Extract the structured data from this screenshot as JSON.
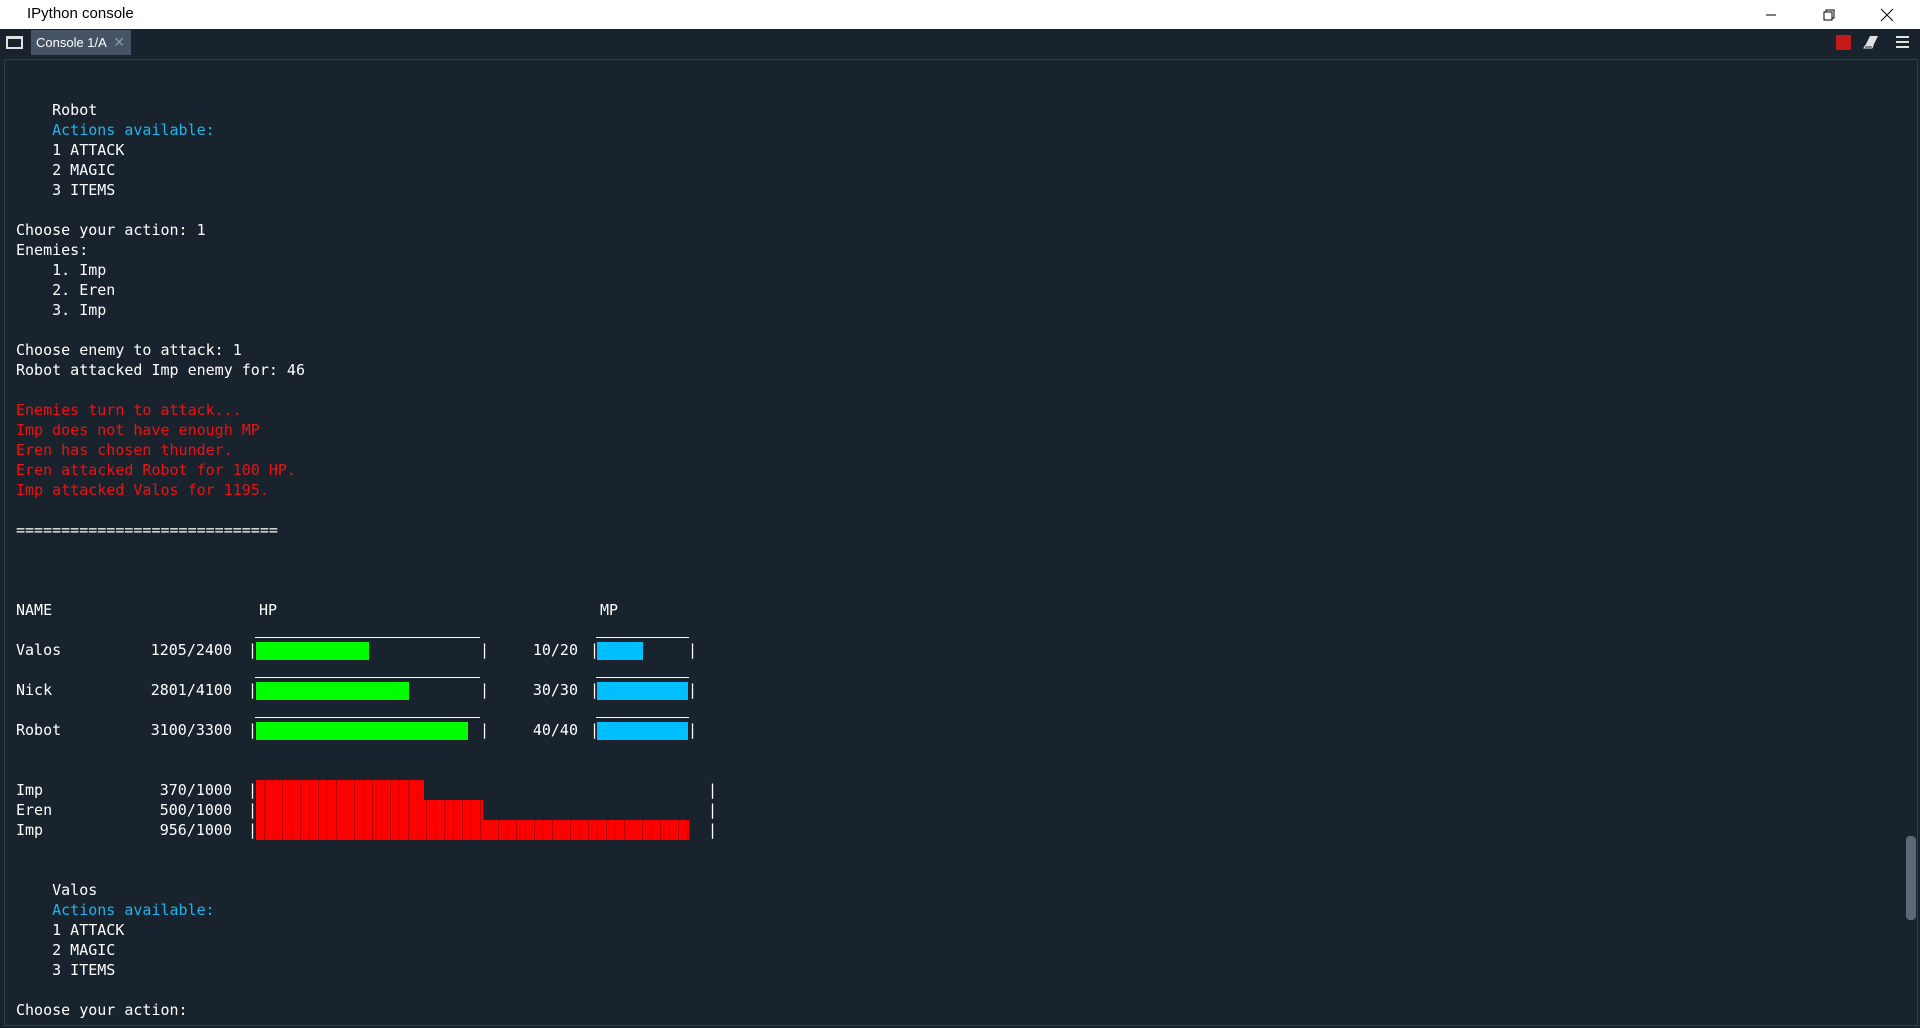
{
  "window": {
    "title": "IPython console"
  },
  "tabs": [
    {
      "label": "Console 1/A"
    }
  ],
  "console_lines": {
    "l1": "    Robot",
    "l2": "    Actions available:",
    "l3": "    1 ATTACK",
    "l4": "    2 MAGIC",
    "l5": "    3 ITEMS",
    "l6": "Choose your action: 1",
    "l7": "Enemies:",
    "l8": "    1. Imp",
    "l9": "    2. Eren",
    "l10": "    3. Imp",
    "l11": "Choose enemy to attack: 1",
    "l12": "Robot attacked Imp enemy for: 46",
    "l13": "Enemies turn to attack...",
    "l14": "Imp does not have enough MP",
    "l15": "Eren has chosen thunder.",
    "l16": "Eren attacked Robot for 100 HP.",
    "l17": "Imp attacked Valos for 1195.",
    "l18": "=============================",
    "hdr_name": "NAME",
    "hdr_hp": "HP",
    "hdr_mp": "MP",
    "l19": "    Valos",
    "l20": "    Actions available:",
    "l21": "    1 ATTACK",
    "l22": "    2 MAGIC",
    "l23": "    3 ITEMS",
    "l24": "Choose your action: "
  },
  "players": [
    {
      "name": "Valos",
      "hp": "1205/2400",
      "mp": "10/20",
      "hp_fraction": 0.5,
      "mp_fraction": 0.5
    },
    {
      "name": "Nick",
      "hp": "2801/4100",
      "mp": "30/30",
      "hp_fraction": 0.68,
      "mp_fraction": 1.0
    },
    {
      "name": "Robot",
      "hp": "3100/3300",
      "mp": "40/40",
      "hp_fraction": 0.94,
      "mp_fraction": 1.0
    }
  ],
  "enemies": [
    {
      "name": "Imp",
      "hp": "370/1000",
      "hp_fraction": 0.37
    },
    {
      "name": "Eren",
      "hp": "500/1000",
      "hp_fraction": 0.5
    },
    {
      "name": "Imp",
      "hp": "956/1000",
      "hp_fraction": 0.956
    }
  ],
  "colors": {
    "hp_player": "#00ff00",
    "mp_player": "#00bfff",
    "hp_enemy": "#ff0000",
    "info": "#19b5ee",
    "enemy_text": "#f01010"
  },
  "icons": [
    "minimize-icon",
    "restore-icon",
    "close-icon",
    "browse-tabs-icon",
    "tab-close-icon",
    "stop-icon",
    "eraser-icon",
    "options-menu-icon"
  ]
}
